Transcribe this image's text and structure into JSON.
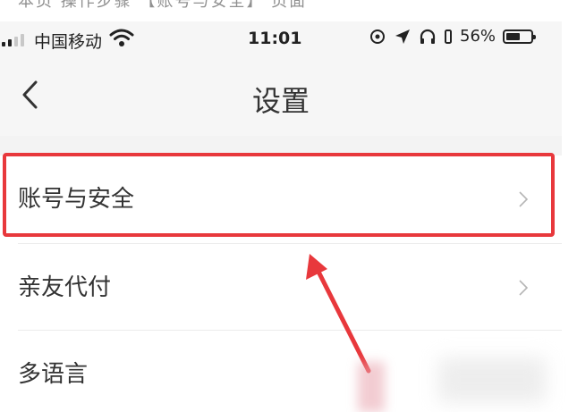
{
  "top_strip": {
    "text": "本页 操作步骤 【账号与安全】 页面"
  },
  "status_bar": {
    "carrier": "中国移动",
    "time": "11:01",
    "battery_percent": "56%",
    "battery_level": 0.56,
    "icons": [
      "signal-icon",
      "wifi-icon",
      "location-lock-icon",
      "location-arrow-icon",
      "headphones-icon",
      "battery-icon"
    ]
  },
  "nav": {
    "title": "设置",
    "back_icon": "back-chevron-icon"
  },
  "settings": {
    "items": [
      {
        "label": "账号与安全",
        "highlighted": true
      },
      {
        "label": "亲友代付",
        "highlighted": false
      },
      {
        "label": "多语言",
        "highlighted": false
      }
    ]
  },
  "annotation": {
    "highlight_color": "#e8383c",
    "arrow_color": "#e8383c"
  }
}
